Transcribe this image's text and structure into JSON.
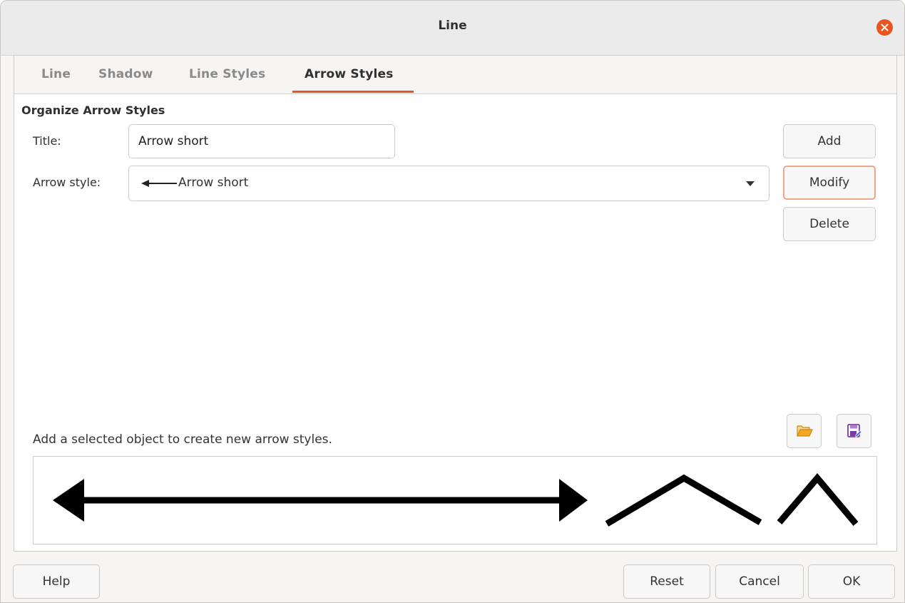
{
  "window": {
    "title": "Line"
  },
  "tabs": [
    {
      "label": "Line",
      "active": false
    },
    {
      "label": "Shadow",
      "active": false
    },
    {
      "label": "Line Styles",
      "active": false
    },
    {
      "label": "Arrow Styles",
      "active": true
    }
  ],
  "section": {
    "title": "Organize Arrow Styles"
  },
  "form": {
    "title_label": "Title:",
    "title_value": "Arrow short",
    "arrow_style_label": "Arrow style:",
    "arrow_style_value": "Arrow short"
  },
  "side_buttons": {
    "add": "Add",
    "modify": "Modify",
    "delete": "Delete"
  },
  "hint": "Add a selected object to create new arrow styles.",
  "icons": {
    "open": "folder-open-icon",
    "save": "save-icon",
    "close": "close-icon"
  },
  "footer": {
    "help": "Help",
    "reset": "Reset",
    "cancel": "Cancel",
    "ok": "OK"
  },
  "colors": {
    "accent": "#e95420",
    "focus_border": "#f0a58a",
    "folder": "#f5a623",
    "save": "#8e44ad"
  }
}
